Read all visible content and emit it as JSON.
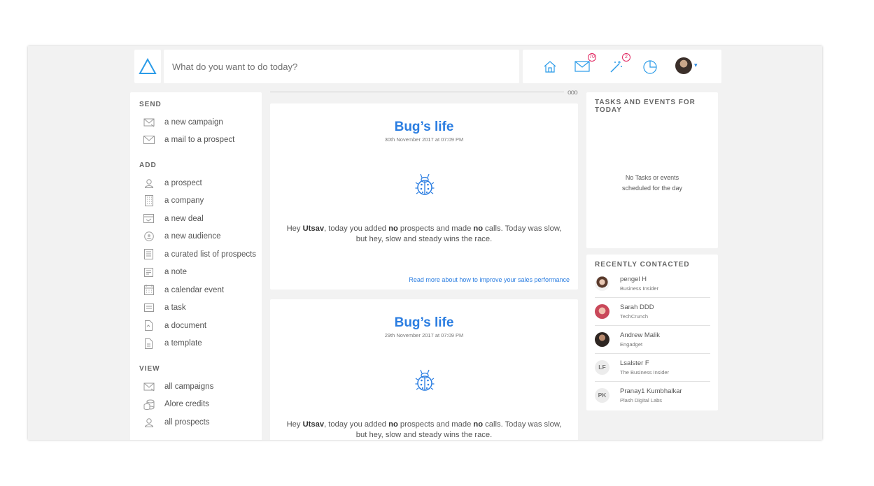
{
  "search": {
    "placeholder": "What do you want to do today?"
  },
  "topbar": {
    "icons": [
      {
        "name": "home-icon"
      },
      {
        "name": "mail-icon",
        "badge": "70"
      },
      {
        "name": "magic-wand-icon",
        "badge": "2"
      },
      {
        "name": "pie-chart-icon"
      }
    ],
    "caret": "▾"
  },
  "sidebar": {
    "send_title": "SEND",
    "send_items": [
      {
        "label": "a new campaign",
        "icon": "campaign-icon"
      },
      {
        "label": "a mail to a prospect",
        "icon": "envelope-icon"
      }
    ],
    "add_title": "ADD",
    "add_items": [
      {
        "label": "a prospect",
        "icon": "user-icon"
      },
      {
        "label": "a company",
        "icon": "building-icon"
      },
      {
        "label": "a new deal",
        "icon": "deal-icon"
      },
      {
        "label": "a new audience",
        "icon": "audience-icon"
      },
      {
        "label": "a curated list of prospects",
        "icon": "list-icon"
      },
      {
        "label": "a note",
        "icon": "note-icon"
      },
      {
        "label": "a calendar event",
        "icon": "calendar-icon"
      },
      {
        "label": "a task",
        "icon": "task-icon"
      },
      {
        "label": "a document",
        "icon": "document-icon"
      },
      {
        "label": "a template",
        "icon": "template-icon"
      }
    ],
    "view_title": "VIEW",
    "view_items": [
      {
        "label": "all campaigns",
        "icon": "campaign-icon"
      },
      {
        "label": "Alore credits",
        "icon": "coins-icon"
      },
      {
        "label": "all prospects",
        "icon": "user-icon"
      }
    ]
  },
  "feed": {
    "more": "ooo",
    "cards": [
      {
        "title": "Bug’s life",
        "date": "30th November 2017 at 07:09 PM",
        "body_pre": "Hey ",
        "user": "Utsav",
        "body_mid1": ", today you added ",
        "no1": "no",
        "body_mid2": " prospects and made ",
        "no2": "no",
        "body_end": " calls. Today was slow, but hey, slow and steady wins the race.",
        "link": "Read more about how to improve your sales performance"
      },
      {
        "title": "Bug’s life",
        "date": "29th November 2017 at 07:09 PM",
        "body_pre": "Hey ",
        "user": "Utsav",
        "body_mid1": ", today you added ",
        "no1": "no",
        "body_mid2": " prospects and made ",
        "no2": "no",
        "body_end": " calls. Today was slow, but hey, slow and steady wins the race."
      }
    ]
  },
  "tasks": {
    "title": "TASKS AND EVENTS FOR TODAY",
    "empty_line1": "No Tasks or events",
    "empty_line2": "scheduled for the day"
  },
  "recent": {
    "title": "RECENTLY CONTACTED",
    "contacts": [
      {
        "name": "pengel H",
        "company": "Business Insider",
        "avatar": "photo"
      },
      {
        "name": "Sarah DDD",
        "company": "TechCrunch",
        "avatar": "photo"
      },
      {
        "name": "Andrew Malik",
        "company": "Engadget",
        "avatar": "photo"
      },
      {
        "name": "Lsalster F",
        "company": "The Business Insider",
        "initials": "LF"
      },
      {
        "name": "Pranay1 Kumbhalkar",
        "company": "Plash Digital Labs",
        "initials": "PK"
      }
    ]
  },
  "colors": {
    "accent": "#2a7de1",
    "badge": "#e0245e",
    "background": "#f2f2f2"
  }
}
